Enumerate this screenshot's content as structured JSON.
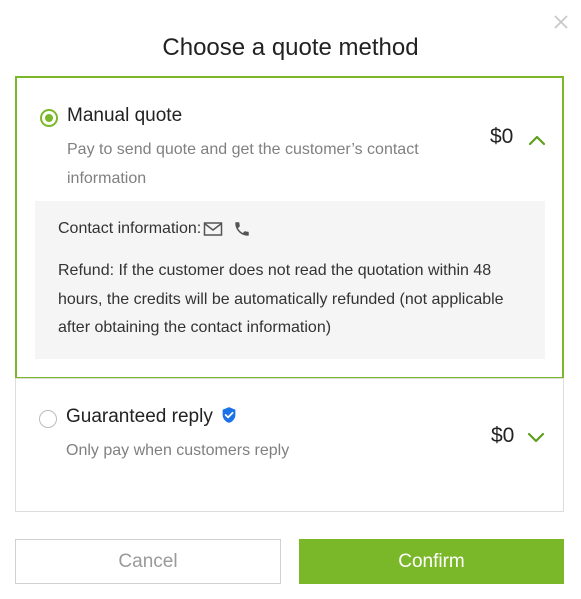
{
  "colors": {
    "accent": "#7ab829",
    "verified_badge": "#1a73e8"
  },
  "dialog": {
    "title": "Choose a quote method"
  },
  "options": [
    {
      "title": "Manual quote",
      "description": "Pay to send quote and get the customer’s contact information",
      "price": "$0",
      "selected": true,
      "expanded": true,
      "details": {
        "contact_label": "Contact information:",
        "contact_icons": [
          "mail-icon",
          "phone-icon"
        ],
        "refund_text": "Refund: If the customer does not read the quotation within 48 hours, the credits will be automatically refunded (not applicable after obtaining the contact information)"
      }
    },
    {
      "title": "Guaranteed reply",
      "badge_icon": "verified-badge-icon",
      "description": "Only pay when customers reply",
      "price": "$0",
      "selected": false,
      "expanded": false
    }
  ],
  "buttons": {
    "cancel": "Cancel",
    "confirm": "Confirm"
  }
}
